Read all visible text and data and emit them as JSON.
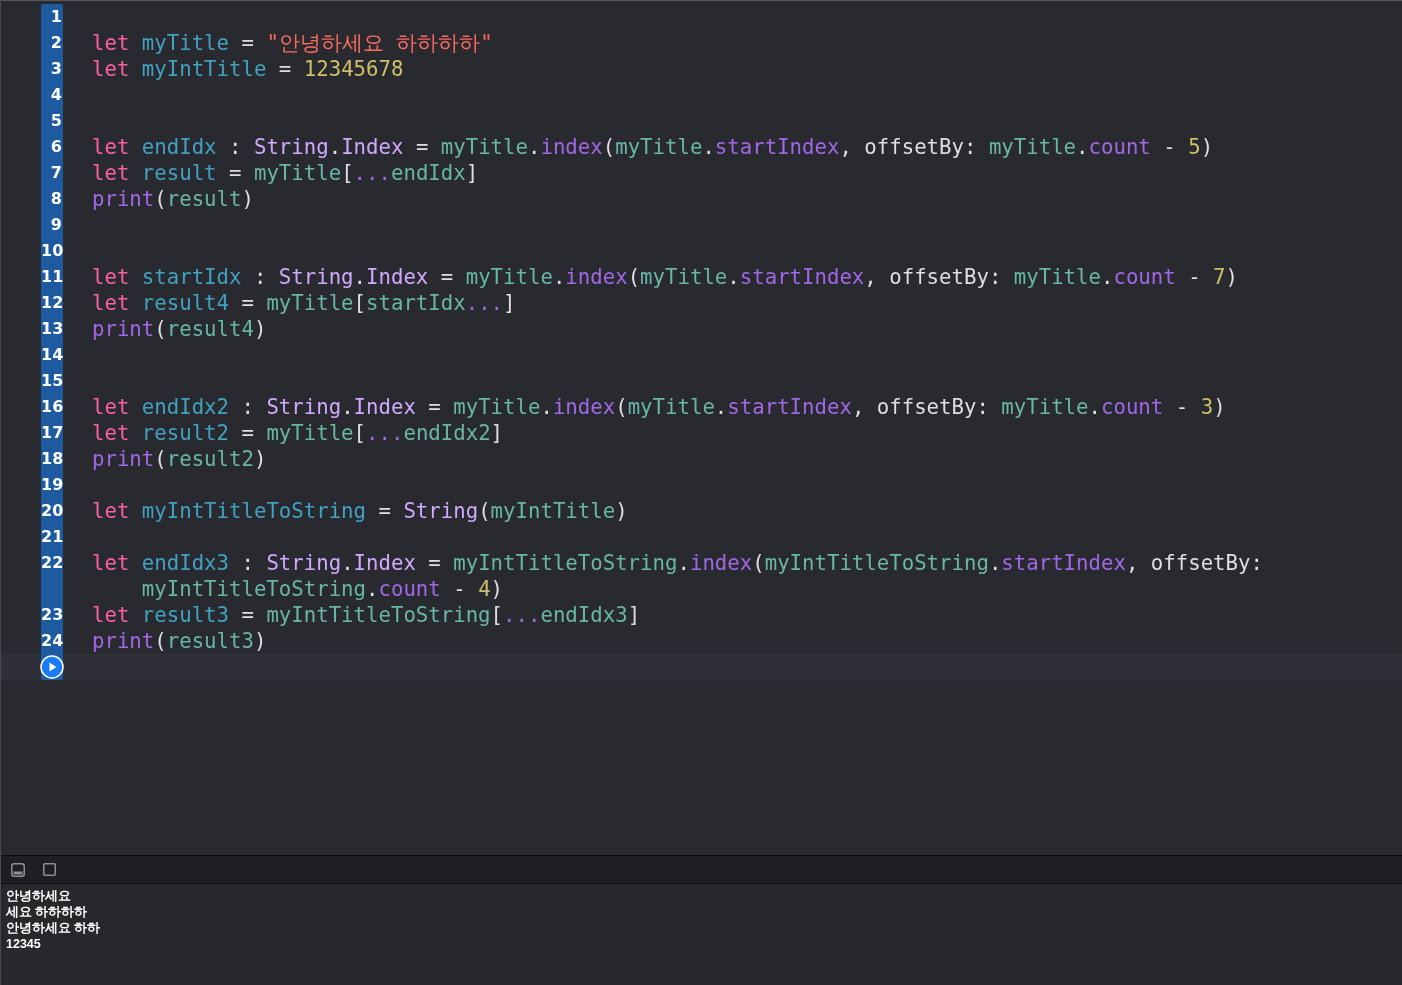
{
  "editor": {
    "lines": [
      {
        "number": "1"
      },
      {
        "number": "2",
        "tokens": [
          {
            "kind": "kw",
            "text": "let "
          },
          {
            "kind": "decl",
            "text": "myTitle"
          },
          {
            "kind": "plain",
            "text": " = "
          },
          {
            "kind": "str",
            "text": "\"안녕하세요 하하하하\""
          }
        ]
      },
      {
        "number": "3",
        "tokens": [
          {
            "kind": "kw",
            "text": "let "
          },
          {
            "kind": "decl",
            "text": "myIntTitle"
          },
          {
            "kind": "plain",
            "text": " = "
          },
          {
            "kind": "num",
            "text": "12345678"
          }
        ]
      },
      {
        "number": "4"
      },
      {
        "number": "5"
      },
      {
        "number": "6",
        "tokens": [
          {
            "kind": "kw",
            "text": "let "
          },
          {
            "kind": "decl",
            "text": "endIdx"
          },
          {
            "kind": "plain",
            "text": " : "
          },
          {
            "kind": "type",
            "text": "String"
          },
          {
            "kind": "plain",
            "text": "."
          },
          {
            "kind": "type",
            "text": "Index"
          },
          {
            "kind": "plain",
            "text": " = "
          },
          {
            "kind": "ref",
            "text": "myTitle"
          },
          {
            "kind": "plain",
            "text": "."
          },
          {
            "kind": "member",
            "text": "index"
          },
          {
            "kind": "plain",
            "text": "("
          },
          {
            "kind": "ref",
            "text": "myTitle"
          },
          {
            "kind": "plain",
            "text": "."
          },
          {
            "kind": "member",
            "text": "startIndex"
          },
          {
            "kind": "plain",
            "text": ", offsetBy: "
          },
          {
            "kind": "ref",
            "text": "myTitle"
          },
          {
            "kind": "plain",
            "text": "."
          },
          {
            "kind": "member",
            "text": "count"
          },
          {
            "kind": "plain",
            "text": " - "
          },
          {
            "kind": "num",
            "text": "5"
          },
          {
            "kind": "plain",
            "text": ")"
          }
        ]
      },
      {
        "number": "7",
        "tokens": [
          {
            "kind": "kw",
            "text": "let "
          },
          {
            "kind": "decl",
            "text": "result"
          },
          {
            "kind": "plain",
            "text": " = "
          },
          {
            "kind": "ref",
            "text": "myTitle"
          },
          {
            "kind": "plain",
            "text": "["
          },
          {
            "kind": "member",
            "text": "..."
          },
          {
            "kind": "ref",
            "text": "endIdx"
          },
          {
            "kind": "plain",
            "text": "]"
          }
        ]
      },
      {
        "number": "8",
        "tokens": [
          {
            "kind": "member",
            "text": "print"
          },
          {
            "kind": "plain",
            "text": "("
          },
          {
            "kind": "ref",
            "text": "result"
          },
          {
            "kind": "plain",
            "text": ")"
          }
        ]
      },
      {
        "number": "9"
      },
      {
        "number": "10"
      },
      {
        "number": "11",
        "tokens": [
          {
            "kind": "kw",
            "text": "let "
          },
          {
            "kind": "decl",
            "text": "startIdx"
          },
          {
            "kind": "plain",
            "text": " : "
          },
          {
            "kind": "type",
            "text": "String"
          },
          {
            "kind": "plain",
            "text": "."
          },
          {
            "kind": "type",
            "text": "Index"
          },
          {
            "kind": "plain",
            "text": " = "
          },
          {
            "kind": "ref",
            "text": "myTitle"
          },
          {
            "kind": "plain",
            "text": "."
          },
          {
            "kind": "member",
            "text": "index"
          },
          {
            "kind": "plain",
            "text": "("
          },
          {
            "kind": "ref",
            "text": "myTitle"
          },
          {
            "kind": "plain",
            "text": "."
          },
          {
            "kind": "member",
            "text": "startIndex"
          },
          {
            "kind": "plain",
            "text": ", offsetBy: "
          },
          {
            "kind": "ref",
            "text": "myTitle"
          },
          {
            "kind": "plain",
            "text": "."
          },
          {
            "kind": "member",
            "text": "count"
          },
          {
            "kind": "plain",
            "text": " - "
          },
          {
            "kind": "num",
            "text": "7"
          },
          {
            "kind": "plain",
            "text": ")"
          }
        ]
      },
      {
        "number": "12",
        "tokens": [
          {
            "kind": "kw",
            "text": "let "
          },
          {
            "kind": "decl",
            "text": "result4"
          },
          {
            "kind": "plain",
            "text": " = "
          },
          {
            "kind": "ref",
            "text": "myTitle"
          },
          {
            "kind": "plain",
            "text": "["
          },
          {
            "kind": "ref",
            "text": "startIdx"
          },
          {
            "kind": "member",
            "text": "..."
          },
          {
            "kind": "plain",
            "text": "]"
          }
        ]
      },
      {
        "number": "13",
        "tokens": [
          {
            "kind": "member",
            "text": "print"
          },
          {
            "kind": "plain",
            "text": "("
          },
          {
            "kind": "ref",
            "text": "result4"
          },
          {
            "kind": "plain",
            "text": ")"
          }
        ]
      },
      {
        "number": "14"
      },
      {
        "number": "15"
      },
      {
        "number": "16",
        "tokens": [
          {
            "kind": "kw",
            "text": "let "
          },
          {
            "kind": "decl",
            "text": "endIdx2"
          },
          {
            "kind": "plain",
            "text": " : "
          },
          {
            "kind": "type",
            "text": "String"
          },
          {
            "kind": "plain",
            "text": "."
          },
          {
            "kind": "type",
            "text": "Index"
          },
          {
            "kind": "plain",
            "text": " = "
          },
          {
            "kind": "ref",
            "text": "myTitle"
          },
          {
            "kind": "plain",
            "text": "."
          },
          {
            "kind": "member",
            "text": "index"
          },
          {
            "kind": "plain",
            "text": "("
          },
          {
            "kind": "ref",
            "text": "myTitle"
          },
          {
            "kind": "plain",
            "text": "."
          },
          {
            "kind": "member",
            "text": "startIndex"
          },
          {
            "kind": "plain",
            "text": ", offsetBy: "
          },
          {
            "kind": "ref",
            "text": "myTitle"
          },
          {
            "kind": "plain",
            "text": "."
          },
          {
            "kind": "member",
            "text": "count"
          },
          {
            "kind": "plain",
            "text": " - "
          },
          {
            "kind": "num",
            "text": "3"
          },
          {
            "kind": "plain",
            "text": ")"
          }
        ]
      },
      {
        "number": "17",
        "tokens": [
          {
            "kind": "kw",
            "text": "let "
          },
          {
            "kind": "decl",
            "text": "result2"
          },
          {
            "kind": "plain",
            "text": " = "
          },
          {
            "kind": "ref",
            "text": "myTitle"
          },
          {
            "kind": "plain",
            "text": "["
          },
          {
            "kind": "member",
            "text": "..."
          },
          {
            "kind": "ref",
            "text": "endIdx2"
          },
          {
            "kind": "plain",
            "text": "]"
          }
        ]
      },
      {
        "number": "18",
        "tokens": [
          {
            "kind": "member",
            "text": "print"
          },
          {
            "kind": "plain",
            "text": "("
          },
          {
            "kind": "ref",
            "text": "result2"
          },
          {
            "kind": "plain",
            "text": ")"
          }
        ]
      },
      {
        "number": "19"
      },
      {
        "number": "20",
        "tokens": [
          {
            "kind": "kw",
            "text": "let "
          },
          {
            "kind": "decl",
            "text": "myIntTitleToString"
          },
          {
            "kind": "plain",
            "text": " = "
          },
          {
            "kind": "type",
            "text": "String"
          },
          {
            "kind": "plain",
            "text": "("
          },
          {
            "kind": "ref",
            "text": "myIntTitle"
          },
          {
            "kind": "plain",
            "text": ")"
          }
        ]
      },
      {
        "number": "21"
      },
      {
        "number": "22",
        "tokens": [
          {
            "kind": "kw",
            "text": "let "
          },
          {
            "kind": "decl",
            "text": "endIdx3"
          },
          {
            "kind": "plain",
            "text": " : "
          },
          {
            "kind": "type",
            "text": "String"
          },
          {
            "kind": "plain",
            "text": "."
          },
          {
            "kind": "type",
            "text": "Index"
          },
          {
            "kind": "plain",
            "text": " = "
          },
          {
            "kind": "ref",
            "text": "myIntTitleToString"
          },
          {
            "kind": "plain",
            "text": "."
          },
          {
            "kind": "member",
            "text": "index"
          },
          {
            "kind": "plain",
            "text": "("
          },
          {
            "kind": "ref",
            "text": "myIntTitleToString"
          },
          {
            "kind": "plain",
            "text": "."
          },
          {
            "kind": "member",
            "text": "startIndex"
          },
          {
            "kind": "plain",
            "text": ", offsetBy: "
          },
          {
            "kind": "ref",
            "text": "myIntTitleToString"
          },
          {
            "kind": "plain",
            "text": "."
          },
          {
            "kind": "member",
            "text": "count"
          },
          {
            "kind": "plain",
            "text": " - "
          },
          {
            "kind": "num",
            "text": "4"
          },
          {
            "kind": "plain",
            "text": ")"
          }
        ]
      },
      {
        "number": "23",
        "tokens": [
          {
            "kind": "kw",
            "text": "let "
          },
          {
            "kind": "decl",
            "text": "result3"
          },
          {
            "kind": "plain",
            "text": " = "
          },
          {
            "kind": "ref",
            "text": "myIntTitleToString"
          },
          {
            "kind": "plain",
            "text": "["
          },
          {
            "kind": "member",
            "text": "..."
          },
          {
            "kind": "ref",
            "text": "endIdx3"
          },
          {
            "kind": "plain",
            "text": "]"
          }
        ]
      },
      {
        "number": "24",
        "tokens": [
          {
            "kind": "member",
            "text": "print"
          },
          {
            "kind": "plain",
            "text": "("
          },
          {
            "kind": "ref",
            "text": "result3"
          },
          {
            "kind": "plain",
            "text": ")"
          }
        ]
      }
    ]
  },
  "console": {
    "output": [
      "안녕하세요",
      "세요 하하하하",
      "안녕하세요 하하",
      "12345"
    ]
  }
}
